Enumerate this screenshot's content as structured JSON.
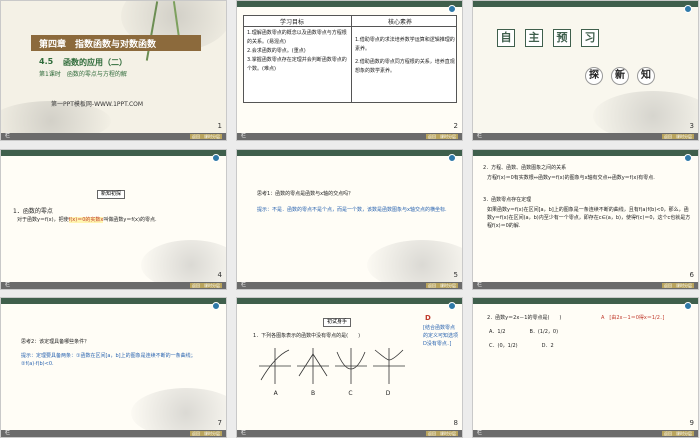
{
  "slides": [
    {
      "page": "1",
      "chapter": "第四章　指数函数与对数函数",
      "section_num": "4.5",
      "section_title": "函数的应用（二）",
      "lesson": "第1课时　函数的零点与方程的解",
      "brand": "第一PPT模板网-WWW.1PPT.COM"
    },
    {
      "page": "2",
      "col1": "学习目标",
      "col2": "核心素养",
      "goals": [
        "1.理解函数零点的概念以及函数零点与方程根的关系。(易混点)",
        "2.会求函数的零点。(重点)",
        "3.掌握函数零点存在定理并会判断函数零点的个数。(难点)"
      ],
      "literacy": [
        "1.借助零点的求法培养数学运算和逻辑推理的素养。",
        "2.借助函数的零点同方程根的关系，培养直观想象的数学素养。"
      ]
    },
    {
      "page": "3",
      "chars1": [
        "自",
        "主",
        "预",
        "习"
      ],
      "chars2": [
        "探",
        "新",
        "知"
      ]
    },
    {
      "page": "4",
      "tag": "新知初探",
      "heading": "1．函数的零点",
      "body_pre": "对于函数y＝f(x)，把使",
      "body_hl": "f(x)＝0的实数x",
      "body_post": "叫做函数y＝f(x)的零点."
    },
    {
      "page": "5",
      "question": "思考1：函数的零点是函数与x轴的交点吗？",
      "answer": "提示：不是．函数的零点不是个点，而是一个数，该数是函数图象与x轴交点的横坐标."
    },
    {
      "page": "6",
      "p1": "2．方程、函数、函数图象之间的关系",
      "p2": "方程f(x)＝0有实数根⇔函数y＝f(x)的图象与x轴有交点⇔函数y＝f(x)有零点.",
      "p3": "3．函数零点存在定理",
      "p4": "如果函数y＝f(x)在区间[a，b]上的图象是一条连续不断的曲线，且有f(a)f(b)<0，那么，函数y＝f(x)在区间(a，b)内至少有一个零点，即存在c∈(a，b)，使得f(c)＝0，这个c也就是方程f(x)＝0的解."
    },
    {
      "page": "7",
      "question": "思考2：该定理具备哪些条件？",
      "answer": "提示：定理要具备两条：①函数在区间[a，b]上的图象是连续不断的一条曲线；②f(a)·f(b)<0."
    },
    {
      "page": "8",
      "tag": "初试身手",
      "q": "1．下列各图象表示的函数中没有零点的是(　　)",
      "opts": [
        "A",
        "B",
        "C",
        "D"
      ],
      "ans_letter": "D",
      "ans_text": "[结合函数零点的定义可知选项D没有零点．]"
    },
    {
      "page": "9",
      "q": "2．函数y＝2x－1的零点是(　　)",
      "ans": "A　[由2x－1＝0得x＝1/2．]",
      "opts": [
        "A．1/2",
        "B．(1/2，0)",
        "C．(0，1/2)",
        "D．2"
      ]
    }
  ],
  "footer": {
    "label": "栏",
    "btn1": "返回",
    "btn2": "课时分层"
  },
  "colors": {
    "header": "#3f5f4c",
    "accent_red": "#c0392b",
    "accent_blue": "#2a64b0",
    "highlight": "#f7e04c"
  }
}
